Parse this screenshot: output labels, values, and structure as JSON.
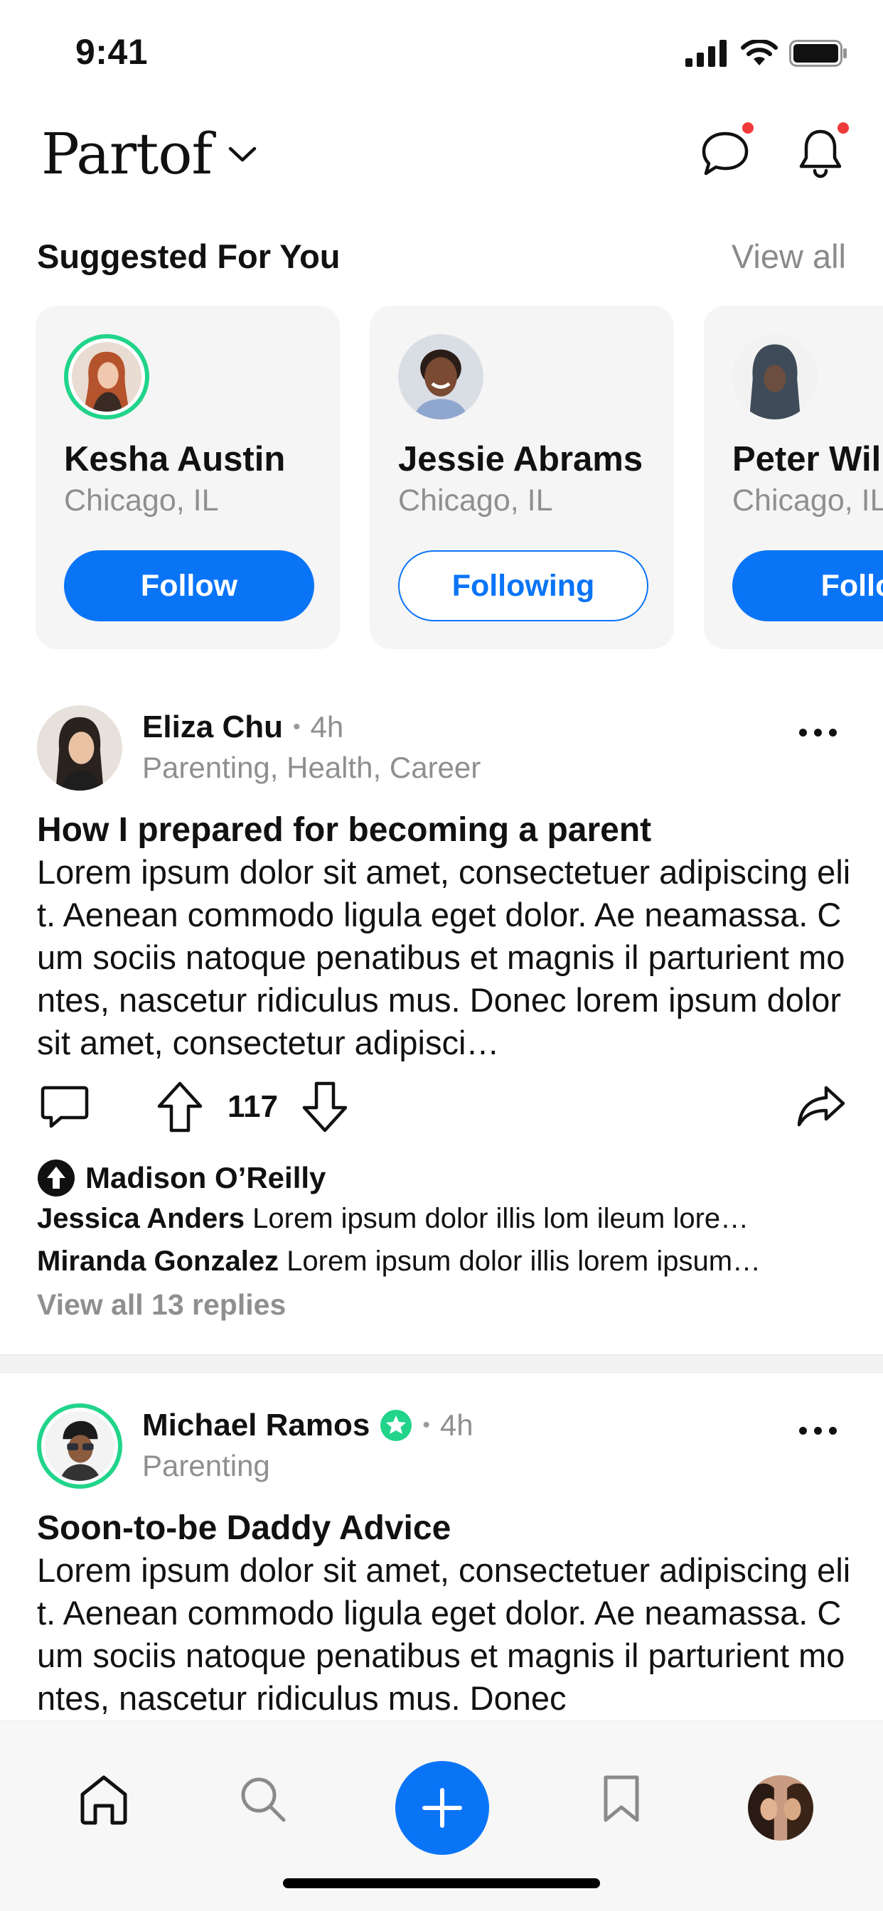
{
  "status_bar": {
    "time": "9:41"
  },
  "header": {
    "brand": "Partof"
  },
  "suggested": {
    "title": "Suggested For You",
    "view_all": "View all",
    "cards": [
      {
        "name": "Kesha Austin",
        "location": "Chicago, IL",
        "button": "Follow"
      },
      {
        "name": "Jessie Abrams",
        "location": "Chicago, IL",
        "button": "Following"
      },
      {
        "name": "Peter Wil",
        "location": "Chicago, IL",
        "button": "Follo"
      }
    ]
  },
  "posts": [
    {
      "author": "Eliza Chu",
      "time": "4h",
      "tags": "Parenting, Health, Career",
      "title": "How I prepared for becoming a parent",
      "body": "Lorem ipsum dolor sit amet, consectetuer adipiscing elit. Aenean commodo ligula eget dolor. Ae neamassa. Cum sociis natoque penatibus et magnis il parturient montes, nascetur ridiculus mus. Donec lorem ipsum dolor sit amet, consectetur adipisci…",
      "votes": "117",
      "upvoted_by": "Madison O’Reilly",
      "replies": [
        {
          "name": "Jessica Anders",
          "text": "Lorem ipsum dolor illis lom ileum lore…"
        },
        {
          "name": "Miranda Gonzalez",
          "text": "Lorem ipsum dolor illis lorem ipsum…"
        }
      ],
      "view_replies": "View all 13 replies"
    },
    {
      "author": "Michael Ramos",
      "time": "4h",
      "tags": "Parenting",
      "title": "Soon-to-be Daddy Advice",
      "body": "Lorem ipsum dolor sit amet, consectetuer adipiscing elit. Aenean commodo ligula eget dolor. Ae neamassa. Cum sociis natoque penatibus et magnis il parturient montes, nascetur ridiculus mus. Donec"
    }
  ],
  "colors": {
    "accent": "#0a74f7",
    "ring": "#21d48a",
    "notification": "#f03a3a"
  }
}
